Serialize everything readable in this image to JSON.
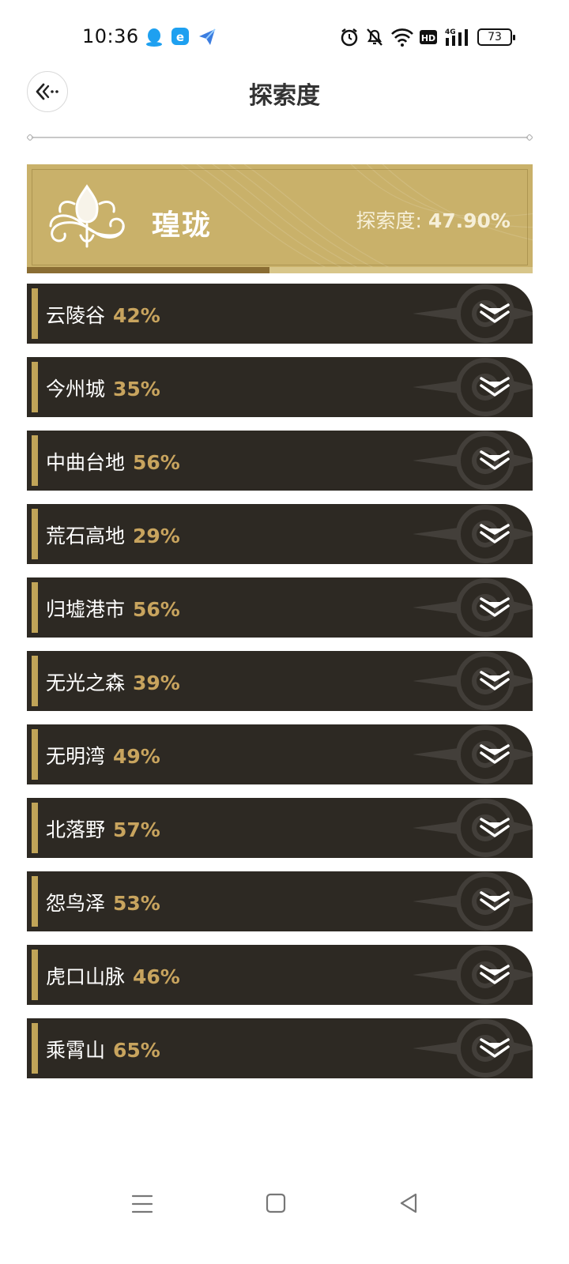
{
  "status_bar": {
    "time": "10:36",
    "apps": [
      "qq-icon",
      "app-e-icon",
      "send-icon"
    ],
    "indicators": [
      "alarm-icon",
      "mute-icon",
      "wifi-icon",
      "hd-icon",
      "signal-4g-icon"
    ],
    "battery": "73"
  },
  "header": {
    "title": "探索度",
    "back_icon": "back-arrow-icon"
  },
  "region": {
    "name": "瑝珑",
    "explore_label": "探索度: ",
    "explore_value": "47.90%",
    "progress": 0.479
  },
  "areas": [
    {
      "name": "云陵谷",
      "pct": "42%"
    },
    {
      "name": "今州城",
      "pct": "35%"
    },
    {
      "name": "中曲台地",
      "pct": "56%"
    },
    {
      "name": "荒石高地",
      "pct": "29%"
    },
    {
      "name": "归墟港市",
      "pct": "56%"
    },
    {
      "name": "无光之森",
      "pct": "39%"
    },
    {
      "name": "无明湾",
      "pct": "49%"
    },
    {
      "name": "北落野",
      "pct": "57%"
    },
    {
      "name": "怨鸟泽",
      "pct": "53%"
    },
    {
      "name": "虎口山脉",
      "pct": "46%"
    },
    {
      "name": "乘霄山",
      "pct": "65%"
    }
  ],
  "colors": {
    "card_gold": "#c9b16a",
    "row_dark": "#2d2923",
    "accent_bar": "#c0a458",
    "pct_gold": "#c8a45e"
  },
  "nav": [
    "menu-icon",
    "home-icon",
    "back-triangle-icon"
  ]
}
